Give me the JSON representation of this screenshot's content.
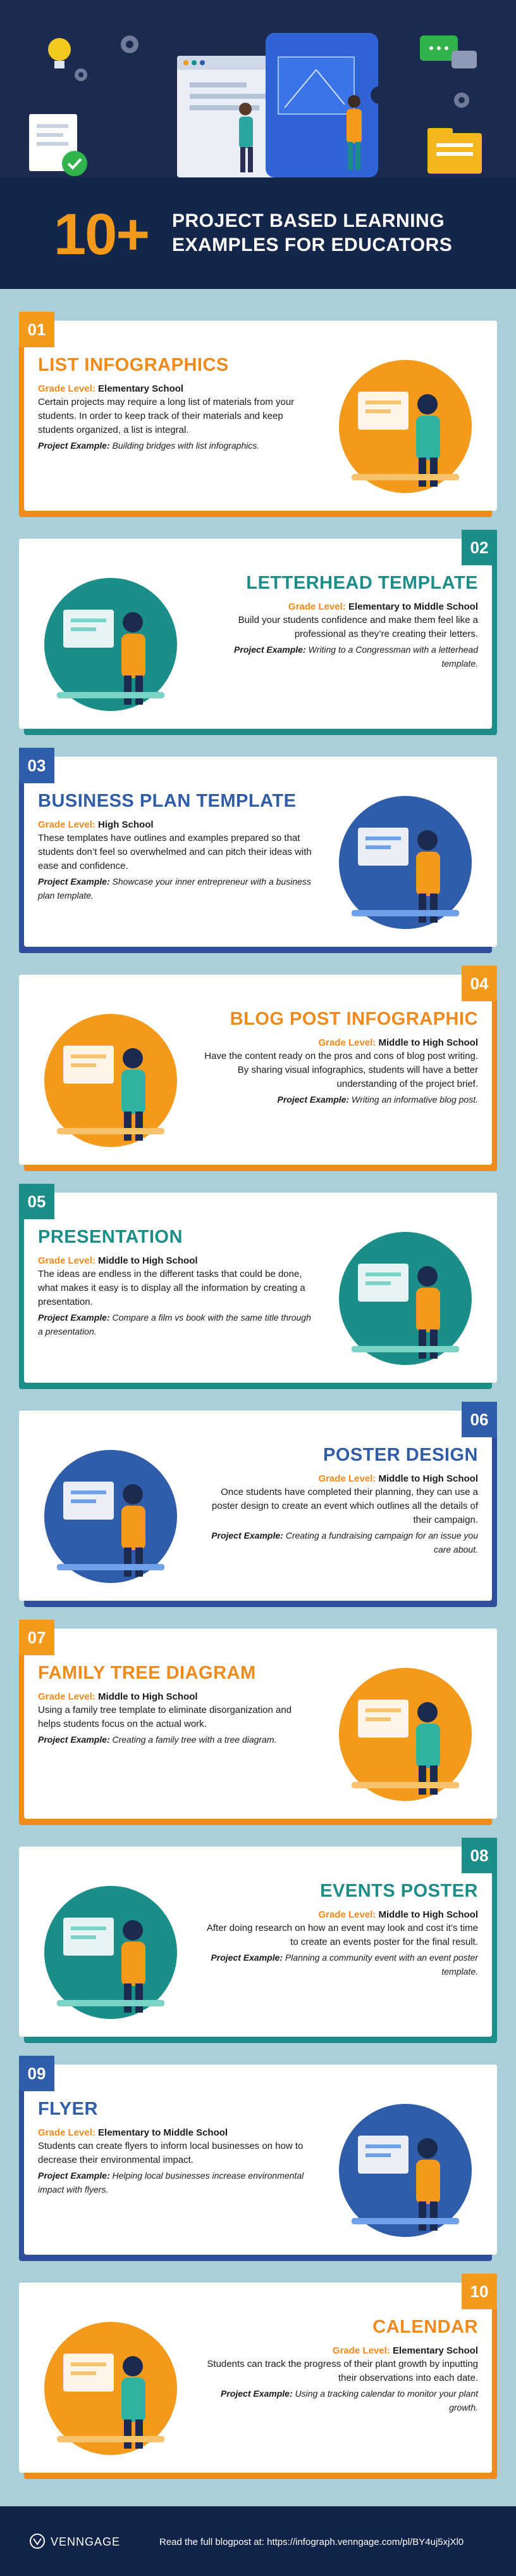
{
  "header": {
    "big_number": "10+",
    "title_line1": "PROJECT BASED LEARNING",
    "title_line2": "EXAMPLES FOR EDUCATORS"
  },
  "labels": {
    "grade": "Grade Level:",
    "project": "Project Example:"
  },
  "colors": {
    "orange": "#f39a1d",
    "teal": "#1b8e8a",
    "blue": "#2f5daa",
    "navy": "#14264a"
  },
  "cards": [
    {
      "num": "01",
      "title": "LIST INFOGRAPHICS",
      "grade": "Elementary School",
      "desc": "Certain projects may require a long list of materials from your students. In order to keep track of their materials and keep students organized, a list is integral.",
      "project": "Building bridges with list infographics.",
      "accent": "orange",
      "illustration": "bridge-illustration"
    },
    {
      "num": "02",
      "title": "LETTERHEAD TEMPLATE",
      "grade": "Elementary to Middle School",
      "desc": "Build your students confidence and make them feel like a professional as they’re creating their letters.",
      "project": "Writing to a Congressman with a letterhead template.",
      "accent": "teal",
      "illustration": "writing-letter-illustration"
    },
    {
      "num": "03",
      "title": "BUSINESS PLAN TEMPLATE",
      "grade": "High School",
      "desc": "These templates have outlines and examples prepared so that students don’t feel so overwhelmed and can pitch their ideas with ease and confidence.",
      "project": "Showcase your inner entrepreneur with a business plan template.",
      "accent": "blue",
      "illustration": "laptop-pitch-illustration"
    },
    {
      "num": "04",
      "title": "BLOG POST INFOGRAPHIC",
      "grade": "Middle to High School",
      "desc": "Have the content ready on the pros and cons of blog post writing. By sharing visual infographics, students will have a better understanding of the project brief.",
      "project": "Writing an informative blog post.",
      "accent": "orange",
      "illustration": "desk-computer-illustration"
    },
    {
      "num": "05",
      "title": "PRESENTATION",
      "grade": "Middle to High School",
      "desc": "The ideas are endless in the different tasks that could be done, what makes it easy is to display all the information by creating a presentation.",
      "project": "Compare a film vs book with the same title through a presentation.",
      "accent": "teal",
      "illustration": "book-presenter-illustration"
    },
    {
      "num": "06",
      "title": "POSTER DESIGN",
      "grade": "Middle to High School",
      "desc": "Once students have completed their planning, they can use a poster design to create an event which outlines all the details of their campaign.",
      "project": "Creating a fundraising campaign for an issue you care about.",
      "accent": "blue",
      "illustration": "painter-illustration"
    },
    {
      "num": "07",
      "title": "FAMILY TREE DIAGRAM",
      "grade": "Middle to High School",
      "desc": "Using a family tree template to eliminate disorganization and helps students focus on the actual work.",
      "project": "Creating a family tree with a tree diagram.",
      "accent": "orange",
      "illustration": "family-illustration"
    },
    {
      "num": "08",
      "title": "EVENTS POSTER",
      "grade": "Middle to High School",
      "desc": "After doing research on how an event may look and cost it’s time to create an events poster for the final result.",
      "project": "Planning a community event with an event poster template.",
      "accent": "teal",
      "illustration": "event-crowd-illustration"
    },
    {
      "num": "09",
      "title": "FLYER",
      "grade": "Elementary to Middle School",
      "desc": "Students can create flyers to inform local businesses on how to decrease their environmental impact.",
      "project": "Helping local businesses increase environmental impact with flyers.",
      "accent": "blue",
      "illustration": "recycle-flyer-illustration"
    },
    {
      "num": "10",
      "title": "CALENDAR",
      "grade": "Elementary School",
      "desc": "Students can track the progress of their plant growth by inputting their observations into each date.",
      "project": "Using a tracking calendar to monitor your plant growth.",
      "accent": "orange",
      "illustration": "calendar-illustration"
    }
  ],
  "footer": {
    "brand": "VENNGAGE",
    "text": "Read the full blogpost at: https://infograph.venngage.com/pl/BY4uj5xjXl0"
  }
}
